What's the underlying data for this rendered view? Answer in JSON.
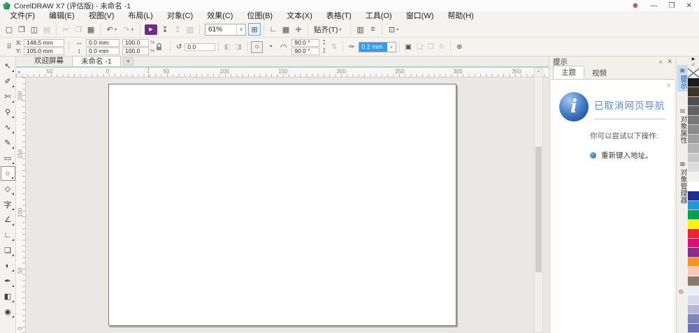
{
  "window": {
    "title": "CorelDRAW X7 (评估版) - 未命名 -1"
  },
  "menu": [
    "文件(F)",
    "编辑(E)",
    "视图(V)",
    "布局(L)",
    "对象(C)",
    "效果(C)",
    "位图(B)",
    "文本(X)",
    "表格(T)",
    "工具(O)",
    "窗口(W)",
    "帮助(H)"
  ],
  "toolbar": {
    "zoom_value": "61%",
    "snap_label": "贴齐(T)"
  },
  "property_bar": {
    "x_label": "X:",
    "x_value": "148.5 mm",
    "y_label": "Y:",
    "y_value": "105.0 mm",
    "width_value": "0.0 mm",
    "height_value": "0.0 mm",
    "scale_x": "100.0",
    "scale_y": "100.0",
    "rotation_value": "0.0",
    "start_angle": "90.0 °",
    "end_angle": "90.0 °",
    "outline_width": "0.2 mm"
  },
  "document_tabs": {
    "welcome": "欢迎屏幕",
    "untitled": "未命名 -1",
    "add": "+"
  },
  "ruler": {
    "h_labels": [
      "50",
      "0",
      "50",
      "100",
      "150",
      "200",
      "250",
      "300",
      "350"
    ],
    "v_labels": [
      "200",
      "150",
      "100",
      "50",
      "0"
    ]
  },
  "toolbox": [
    {
      "name": "pick-tool",
      "glyph": "↖"
    },
    {
      "name": "shape-tool",
      "glyph": "✐"
    },
    {
      "name": "crop-tool",
      "glyph": "✄"
    },
    {
      "name": "zoom-tool",
      "glyph": "⚲"
    },
    {
      "name": "freehand-tool",
      "glyph": "∿"
    },
    {
      "name": "artistic-media-tool",
      "glyph": "✎"
    },
    {
      "name": "rectangle-tool",
      "glyph": "▭"
    },
    {
      "name": "ellipse-tool",
      "glyph": "○",
      "selected": true
    },
    {
      "name": "polygon-tool",
      "glyph": "◇"
    },
    {
      "name": "text-tool",
      "glyph": "字"
    },
    {
      "name": "dimension-tool",
      "glyph": "∠"
    },
    {
      "name": "connector-tool",
      "glyph": "∟"
    },
    {
      "name": "drop-shadow-tool",
      "glyph": "❏"
    },
    {
      "name": "transparency-tool",
      "glyph": "◐"
    },
    {
      "name": "eyedropper-tool",
      "glyph": "✒"
    },
    {
      "name": "interactive-fill-tool",
      "glyph": "◧"
    },
    {
      "name": "smart-fill-tool",
      "glyph": "◉"
    }
  ],
  "hints": {
    "title": "提示",
    "tab_theme": "主题",
    "tab_video": "视频",
    "heading": "已取消网页导航",
    "intro": "你可以尝试以下操作:",
    "action": "重新键入地址。"
  },
  "dockers": {
    "hints": "提示",
    "object_properties": "对象属性",
    "object_manager": "对象管理器"
  },
  "palette": [
    "none",
    "#1c1c1c",
    "#3e3428",
    "#4f4f4f",
    "#636363",
    "#777777",
    "#8b8b8b",
    "#9f9f9f",
    "#b4b4b4",
    "#c8c8c8",
    "#dddddd",
    "#f1f1f1",
    "#ffffff",
    "#232c8c",
    "#1e9ad6",
    "#00a14e",
    "#fff200",
    "#e9282d",
    "#de0b7d",
    "#8f2b8e",
    "#f7941d",
    "#f8c7bb",
    "#877a6c",
    "#edecf5",
    "#d9d8ec",
    "#b8b7d8",
    "#7e87ba",
    "#6c73b3"
  ],
  "colors": {
    "accent": "#2f7bc4",
    "selection": "#3399ff",
    "heading_blue": "#5b8fc9",
    "palette_active_tab": "#c3dcf3"
  },
  "icons": {
    "new_doc": "▢",
    "open": "❒",
    "save": "◫",
    "print": "▤",
    "cut": "✂",
    "copy": "❐",
    "paste": "▦",
    "undo": "↶",
    "redo": "↷",
    "search_play": "▶",
    "import": "↧",
    "export": "↥",
    "caret": "▾",
    "combo_caret": "∨",
    "fullscreen": "⊞",
    "rulers": "∟",
    "grid": "▦",
    "guidelines": "✛",
    "doc_options": "▥",
    "view_options": "≡",
    "app_launcher": "⊡",
    "position_grid": "⠿",
    "size_h": "↔",
    "size_v": "↕",
    "percent": "%",
    "rotate": "↺",
    "mirror_h": "◧",
    "mirror_v": "◨",
    "ellipse": "○",
    "pie": "◔",
    "arc": "◠",
    "spin_up": "▴",
    "spin_down": "▾",
    "swap": "⇅",
    "outline_pen": "✑",
    "wrap_text": "▣",
    "to_front": "❏",
    "to_back": "❐",
    "refresh": "↻",
    "quick_customize": "⊕",
    "account": "☻",
    "minimize": "—",
    "restore": "❐",
    "close": "✕",
    "panel_collapse": "»",
    "panel_close": "✕",
    "scroll_up": "∧",
    "scroll_up_small": "⌃",
    "palette_flyout": "▶",
    "palette_pen": "✐",
    "docker_add": "⊕",
    "ruler_origin": "⌗",
    "info": "i",
    "docker_hints": "▣",
    "docker_props": "▤",
    "docker_manager": "▦"
  }
}
